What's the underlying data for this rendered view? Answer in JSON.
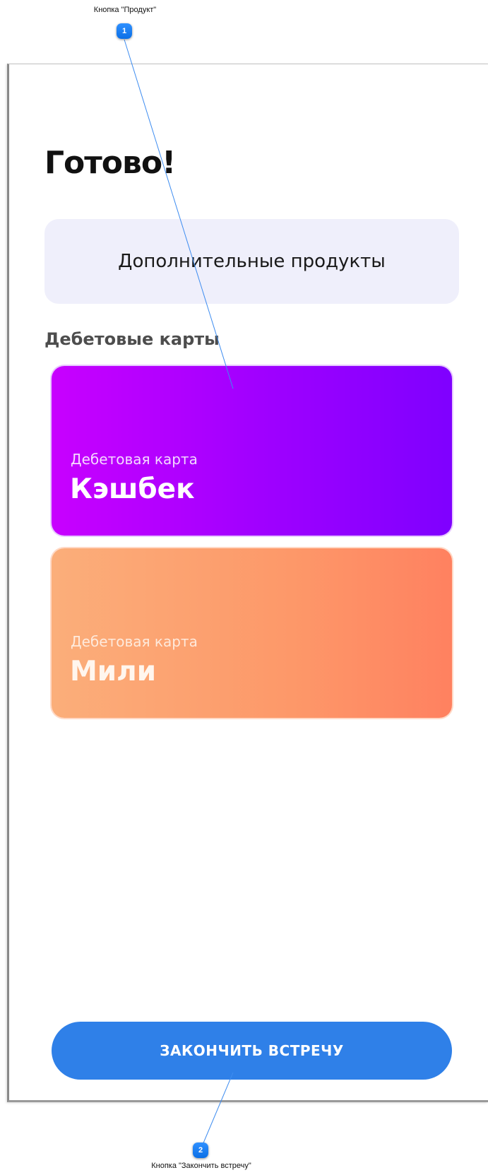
{
  "annotations": [
    {
      "number": "1",
      "label": "Кнопка \"Продукт\""
    },
    {
      "number": "2",
      "label": "Кнопка \"Закончить встречу\""
    }
  ],
  "screen": {
    "title": "Готово!",
    "extra_products_label": "Дополнительные продукты",
    "section_heading": "Дебетовые карты",
    "cards": [
      {
        "kind": "Дебетовая карта",
        "name": "Кэшбек",
        "gradient": [
          "#c800ff",
          "#7f00ff"
        ]
      },
      {
        "kind": "Дебетовая карта",
        "name": "Мили",
        "gradient": [
          "#fbae7a",
          "#ff8160"
        ]
      }
    ],
    "finish_button_label": "ЗАКОНЧИТЬ ВСТРЕЧУ"
  },
  "colors": {
    "accent_blue": "#2f80e8",
    "callout_blue": "#1a7cf0",
    "extra_products_bg": "#efeffb"
  }
}
